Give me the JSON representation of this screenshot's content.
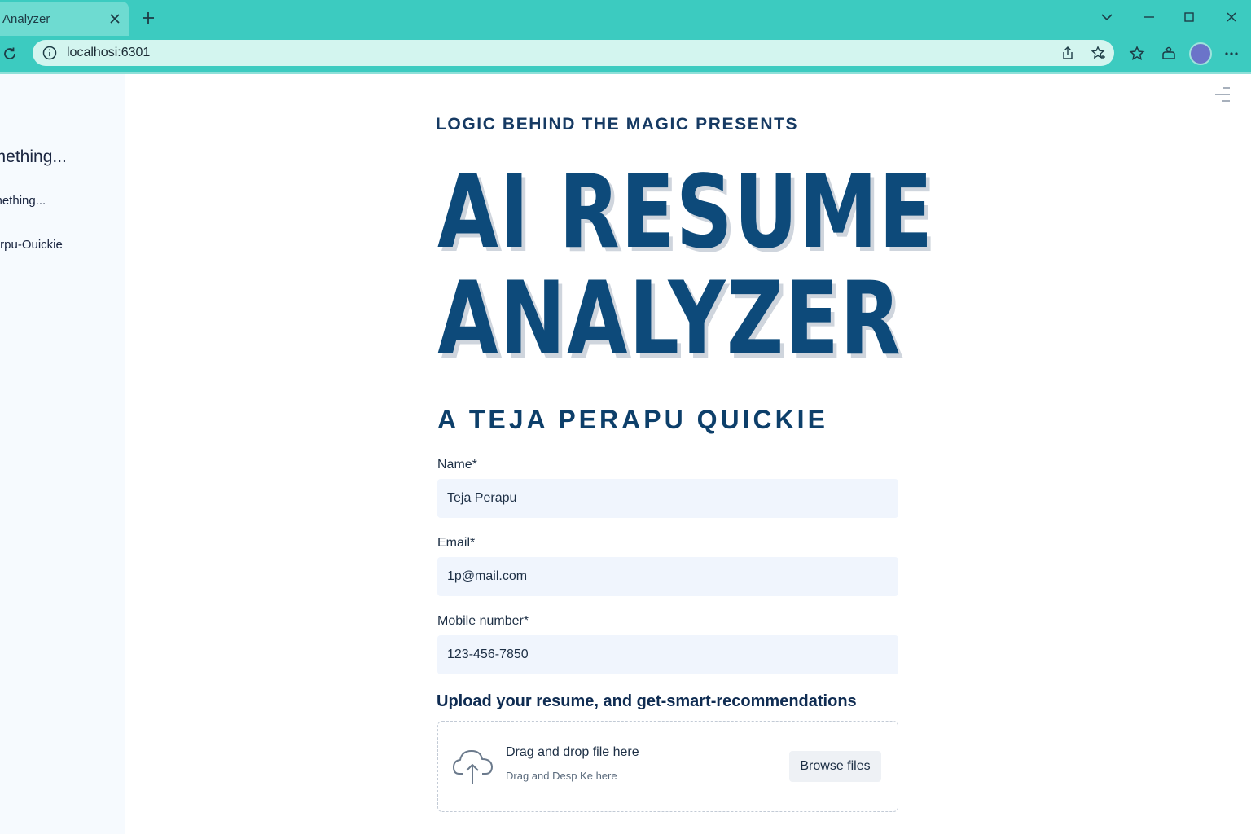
{
  "browser": {
    "tab_title": "Analyzer",
    "url": "localhosi:6301"
  },
  "sidebar": {
    "heading": "omething...",
    "items": [
      {
        "label": "omething..."
      },
      {
        "label": "trpu-Ouickie"
      }
    ]
  },
  "main": {
    "eyebrow": "LOGIC BEHIND THE MAGIC PRESENTS",
    "title_line1": "AI RESUME",
    "title_line2": "ANALYZER",
    "subtitle": "A TEJA PERAPU QUICKIE"
  },
  "form": {
    "name_label": "Name*",
    "name_value": "Teja Perapu",
    "email_label": "Email*",
    "email_value": "1p@mail.com",
    "mobile_label": "Mobile number*",
    "mobile_value": "123-456-7850"
  },
  "upload": {
    "title": "Upload your resume, and get-smart-recommendations",
    "drop_title": "Drag and drop file here",
    "drop_subtitle": "Drag and Desp Ke here",
    "browse_label": "Browse files"
  },
  "colors": {
    "chrome": "#3ccbc0",
    "title_blue": "#0d4a7a",
    "field_bg": "#f0f5fd"
  }
}
